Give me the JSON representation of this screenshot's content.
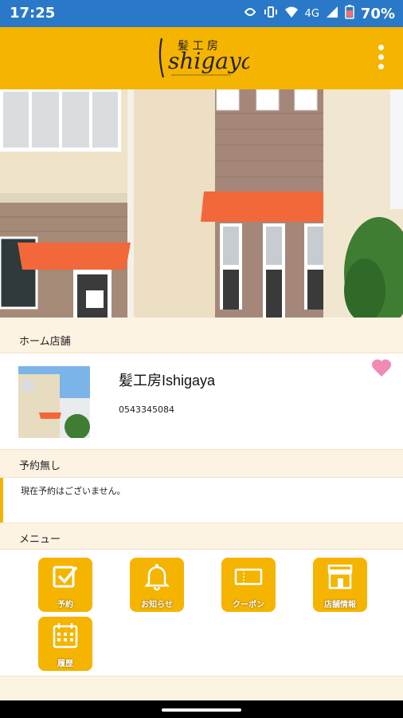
{
  "status_bar": {
    "time": "17:25",
    "network": "4G",
    "battery": "70%"
  },
  "app_bar": {
    "logo_text": "Ishigaya",
    "logo_kanji": "髪工房",
    "logo_icon": "ishigaya-logo",
    "menu_icon": "more-vert-icon"
  },
  "hero": {
    "image": "salon-building-photo"
  },
  "home_store": {
    "section_title": "ホーム店舗",
    "name": "髪工房Ishigaya",
    "phone": "0543345084",
    "favorite_icon": "heart-icon",
    "favorite_color": "#f08bb5"
  },
  "reservation": {
    "section_title": "予約無し",
    "message": "現在予約はございません。"
  },
  "menu": {
    "section_title": "メニュー",
    "items": [
      {
        "label": "予約",
        "icon": "checkbox-icon"
      },
      {
        "label": "お知らせ",
        "icon": "bell-icon"
      },
      {
        "label": "クーポン",
        "icon": "coupon-icon"
      },
      {
        "label": "店舗情報",
        "icon": "store-icon"
      },
      {
        "label": "履歴",
        "icon": "calendar-icon"
      }
    ]
  },
  "colors": {
    "accent": "#f5b400",
    "status_bar": "#2979c8",
    "section_bg": "#fdf3e3"
  }
}
